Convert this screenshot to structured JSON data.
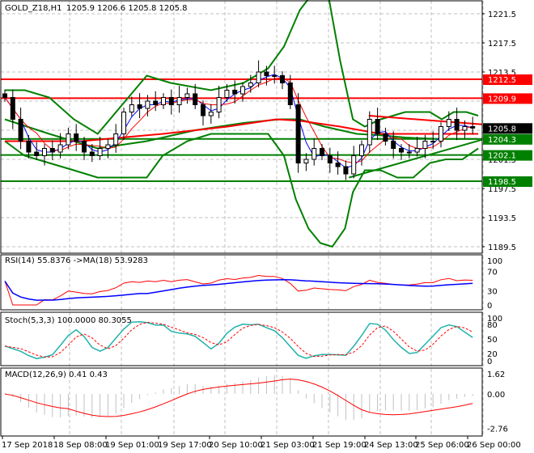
{
  "header": {
    "symbol": "GOLD_Z18,H1",
    "ohlc": "1205.9 1206.6 1205.8 1205.8"
  },
  "rsi_panel": {
    "label": "RSI(14) 55.8376  ->MA(18) 53.9283",
    "levels": [
      "100",
      "70",
      "30",
      "0"
    ]
  },
  "stoch_panel": {
    "label": "Stoch(5,3,3) 100.0000 80.3055",
    "levels": [
      "100",
      "80",
      "50",
      "20",
      "0"
    ]
  },
  "macd_panel": {
    "label": "MACD(12,26,9) 0.41 0.43",
    "levels": [
      "1.62",
      "0.00",
      "-2.76"
    ]
  },
  "colors": {
    "up": "#ffffff",
    "down": "#000000",
    "bands": "#008000",
    "ma_slow": "#ff0000",
    "level_red": "#ff0000",
    "level_green": "#008000",
    "rsi": "#ff0000",
    "rsi_ma": "#0000ff",
    "stoch_k": "#20b2aa",
    "stoch_d": "#ff0000",
    "macd_hist": "#c0c0c0",
    "macd_signal": "#ff0000"
  },
  "chart_data": {
    "type": "candlestick",
    "title": "GOLD_Z18,H1",
    "price_axis": {
      "ticks": [
        "1221.5",
        "1217.5",
        "1213.5",
        "1209.5",
        "1205.5",
        "1201.5",
        "1197.5",
        "1193.5",
        "1189.5"
      ],
      "range": [
        1189.5,
        1221.5
      ]
    },
    "time_axis": {
      "ticks": [
        "17 Sep 2018",
        "18 Sep 08:00",
        "19 Sep 01:00",
        "19 Sep 17:00",
        "20 Sep 10:00",
        "21 Sep 03:00",
        "21 Sep 19:00",
        "24 Sep 13:00",
        "25 Sep 06:00",
        "26 Sep 00:00"
      ]
    },
    "closes": [
      1210,
      1207,
      1204,
      1202.5,
      1202,
      1203,
      1202.5,
      1203.5,
      1205,
      1204,
      1202.5,
      1202,
      1203,
      1203.5,
      1205,
      1208,
      1209,
      1208.5,
      1209.5,
      1209,
      1210,
      1209,
      1210,
      1210.5,
      1209,
      1207.5,
      1208,
      1210,
      1211,
      1210.5,
      1211.5,
      1212,
      1213.5,
      1213,
      1213,
      1212,
      1209,
      1201,
      1201.5,
      1203,
      1202,
      1201,
      1200.5,
      1199.5,
      1202,
      1203.5,
      1207,
      1205,
      1204,
      1203,
      1202.5,
      1202.5,
      1203,
      1204,
      1204,
      1206,
      1207,
      1205.5,
      1206,
      1205.8
    ],
    "bollinger_upper": [
      [
        0,
        1211
      ],
      [
        2.5,
        1211
      ],
      [
        5.6,
        1210
      ],
      [
        8.7,
        1207
      ],
      [
        11.7,
        1205
      ],
      [
        14.8,
        1209
      ],
      [
        17.9,
        1213
      ],
      [
        20.9,
        1212
      ],
      [
        26,
        1211
      ],
      [
        30.1,
        1212
      ],
      [
        33.2,
        1214
      ],
      [
        35.2,
        1217
      ],
      [
        37.2,
        1222
      ],
      [
        39.3,
        1225
      ],
      [
        40.8,
        1224
      ],
      [
        42.3,
        1215
      ],
      [
        43.9,
        1207
      ],
      [
        45.4,
        1206
      ],
      [
        47.4,
        1207
      ],
      [
        50.5,
        1208
      ],
      [
        53.6,
        1208
      ],
      [
        55.1,
        1207
      ],
      [
        56.6,
        1208
      ],
      [
        58.2,
        1208
      ],
      [
        59.7,
        1207.5
      ]
    ],
    "bollinger_lower": [
      [
        0,
        1204
      ],
      [
        2.5,
        1202
      ],
      [
        5.6,
        1201
      ],
      [
        8.7,
        1200
      ],
      [
        11.7,
        1199
      ],
      [
        14.8,
        1199
      ],
      [
        17.9,
        1199
      ],
      [
        19.9,
        1202
      ],
      [
        23,
        1204
      ],
      [
        26,
        1205
      ],
      [
        30.1,
        1205
      ],
      [
        33.2,
        1205
      ],
      [
        35.2,
        1202
      ],
      [
        36.7,
        1196
      ],
      [
        38.3,
        1192
      ],
      [
        39.8,
        1190
      ],
      [
        41.3,
        1189.5
      ],
      [
        42.9,
        1192
      ],
      [
        43.9,
        1197
      ],
      [
        45.4,
        1200
      ],
      [
        47.4,
        1200
      ],
      [
        49.5,
        1199
      ],
      [
        51.5,
        1199
      ],
      [
        53.6,
        1201
      ],
      [
        55.6,
        1201.5
      ],
      [
        57.7,
        1201.5
      ],
      [
        59.7,
        1203
      ]
    ],
    "bollinger_middle": [
      [
        0,
        1207
      ],
      [
        5.6,
        1205
      ],
      [
        11.7,
        1203
      ],
      [
        17.9,
        1204
      ],
      [
        24,
        1205.5
      ],
      [
        30.1,
        1206.5
      ],
      [
        34.7,
        1207
      ],
      [
        37.2,
        1207
      ],
      [
        40.3,
        1206
      ],
      [
        44.4,
        1205
      ],
      [
        47.4,
        1204.8
      ],
      [
        50.5,
        1204.5
      ],
      [
        54.6,
        1204.3
      ],
      [
        59.7,
        1204.3
      ]
    ],
    "ma_slow": [
      [
        0,
        1204
      ],
      [
        9.7,
        1204
      ],
      [
        19.9,
        1205
      ],
      [
        28.1,
        1206
      ],
      [
        34.2,
        1207
      ],
      [
        37.2,
        1206.8
      ],
      [
        42.3,
        1206
      ],
      [
        47.4,
        1205
      ],
      [
        54.6,
        1205
      ],
      [
        59.7,
        1205
      ]
    ],
    "trendlines": [
      {
        "color": "green",
        "from": [
          43.4,
          1199
        ],
        "to": [
          60.2,
          1204.2
        ]
      },
      {
        "color": "red",
        "from": [
          45.9,
          1207.5
        ],
        "to": [
          60.2,
          1206.3
        ]
      }
    ],
    "levels": [
      {
        "value": "1212.5",
        "color": "red"
      },
      {
        "value": "1209.9",
        "color": "red"
      },
      {
        "value": "1204.3",
        "color": "green"
      },
      {
        "value": "1202.1",
        "color": "green"
      },
      {
        "value": "1198.5",
        "color": "green"
      }
    ],
    "current_price": "1205.8"
  }
}
